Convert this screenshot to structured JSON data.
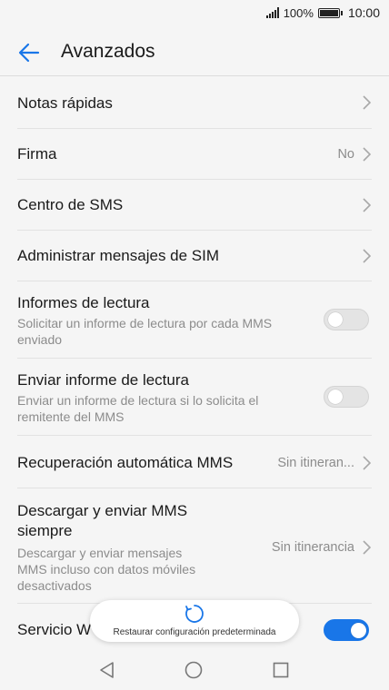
{
  "status_bar": {
    "battery": "100%",
    "time": "10:00"
  },
  "header": {
    "title": "Avanzados"
  },
  "settings": [
    {
      "title": "Notas rápidas"
    },
    {
      "title": "Firma",
      "value": "No"
    },
    {
      "title": "Centro de SMS"
    },
    {
      "title": "Administrar mensajes de SIM"
    },
    {
      "title": "Informes de lectura",
      "subtitle_1": "Solicitar un informe de lectura por cada MMS",
      "subtitle_2": "enviado",
      "toggle": "off"
    },
    {
      "title": "Enviar informe de lectura",
      "subtitle_1": "Enviar un informe de lectura si lo solicita el",
      "subtitle_2": "remitente del MMS",
      "toggle": "off"
    },
    {
      "title": "Recuperación automática MMS",
      "value": "Sin itineran..."
    },
    {
      "title_1": "Descargar y enviar MMS",
      "title_2": "siempre",
      "subtitle_1": "Descargar y enviar mensajes",
      "subtitle_2": "MMS incluso con datos móviles",
      "subtitle_3": "desactivados",
      "value": "Sin itinerancia"
    },
    {
      "title": "Servicio W",
      "toggle": "on"
    }
  ],
  "toast": {
    "text": "Restaurar configuración predeterminada"
  },
  "icons": {
    "back": "arrow-left-icon",
    "chevron": "chevron-right-icon",
    "spinner": "loading-spinner-icon",
    "nav_back": "triangle-back-icon",
    "nav_home": "circle-home-icon",
    "nav_recent": "square-recent-icon"
  },
  "colors": {
    "accent": "#1976e8",
    "background": "#f5f5f5",
    "secondary_text": "#8c8c8c"
  }
}
